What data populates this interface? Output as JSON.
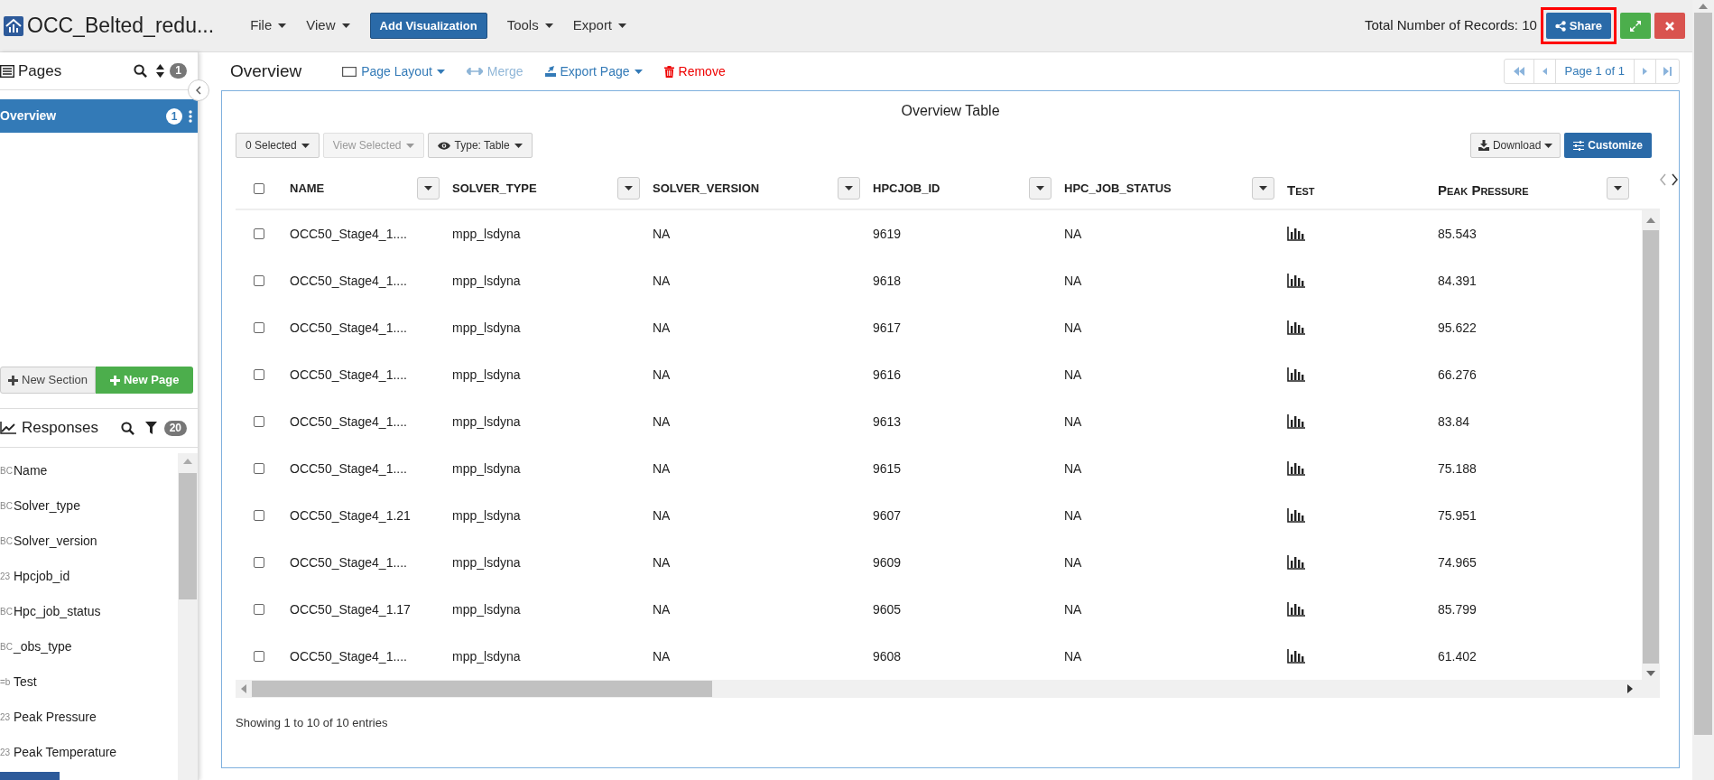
{
  "app": {
    "title": "OCC_Belted_redu..."
  },
  "menu": [
    {
      "kind": "dropdown",
      "label": "File"
    },
    {
      "kind": "dropdown",
      "label": "View"
    },
    {
      "kind": "primary",
      "label": "Add Visualization"
    },
    {
      "kind": "dropdown",
      "label": "Tools"
    },
    {
      "kind": "dropdown",
      "label": "Export"
    }
  ],
  "records": "Total Number of Records: 10",
  "share_button": {
    "label": "Share",
    "highlighted": true
  },
  "pages": {
    "title": "Pages",
    "count": "1",
    "items": [
      {
        "label": "Overview",
        "badge": "1",
        "selected": true
      }
    ],
    "new_section": "New Section",
    "new_page": "New Page"
  },
  "responses": {
    "title": "Responses",
    "count": "20",
    "items": [
      {
        "type_label": "BC",
        "label": "Name"
      },
      {
        "type_label": "BC",
        "label": "Solver_type"
      },
      {
        "type_label": "BC",
        "label": "Solver_version"
      },
      {
        "type_label": "23",
        "label": "Hpcjob_id"
      },
      {
        "type_label": "BC",
        "label": "Hpc_job_status"
      },
      {
        "type_label": "BC",
        "label": "_obs_type"
      },
      {
        "type_label": "=b",
        "label": "Test"
      },
      {
        "type_label": "23",
        "label": "Peak Pressure"
      },
      {
        "type_label": "23",
        "label": "Peak Temperature"
      }
    ]
  },
  "page": {
    "title": "Overview",
    "actions": [
      {
        "kind": "layout",
        "label": "Page Layout",
        "disabled": false
      },
      {
        "kind": "merge",
        "label": "Merge",
        "disabled": true
      },
      {
        "kind": "export",
        "label": "Export Page",
        "disabled": false
      },
      {
        "kind": "remove",
        "label": "Remove",
        "disabled": false
      }
    ],
    "pager": "Page 1 of 1"
  },
  "table": {
    "title": "Overview Table",
    "toolbar": [
      {
        "kind": "menu",
        "label": "0 Selected",
        "disabled": false
      },
      {
        "kind": "menu",
        "label": "View Selected",
        "disabled": true
      },
      {
        "kind": "view",
        "label": "Type: Table",
        "disabled": false
      }
    ],
    "select_all_checked": false,
    "download": "Download",
    "customize": "Customize",
    "columns": [
      {
        "kind": "text",
        "label": "NAME",
        "small_caps": false
      },
      {
        "kind": "text",
        "label": "SOLVER_TYPE",
        "small_caps": false
      },
      {
        "kind": "text",
        "label": "SOLVER_VERSION",
        "small_caps": false
      },
      {
        "kind": "text",
        "label": "HPCJOB_ID",
        "small_caps": false
      },
      {
        "kind": "text",
        "label": "HPC_JOB_STATUS",
        "small_caps": false
      },
      {
        "kind": "chart",
        "label": "Test",
        "small_caps": true
      },
      {
        "kind": "text",
        "label": "Peak Pressure",
        "small_caps": true
      }
    ],
    "rows": [
      {
        "checked": false,
        "cells": [
          "OCC50_Stage4_1....",
          "mpp_lsdyna",
          "NA",
          "9619",
          "NA",
          "",
          "85.543"
        ]
      },
      {
        "checked": false,
        "cells": [
          "OCC50_Stage4_1....",
          "mpp_lsdyna",
          "NA",
          "9618",
          "NA",
          "",
          "84.391"
        ]
      },
      {
        "checked": false,
        "cells": [
          "OCC50_Stage4_1....",
          "mpp_lsdyna",
          "NA",
          "9617",
          "NA",
          "",
          "95.622"
        ]
      },
      {
        "checked": false,
        "cells": [
          "OCC50_Stage4_1....",
          "mpp_lsdyna",
          "NA",
          "9616",
          "NA",
          "",
          "66.276"
        ]
      },
      {
        "checked": false,
        "cells": [
          "OCC50_Stage4_1....",
          "mpp_lsdyna",
          "NA",
          "9613",
          "NA",
          "",
          "83.84"
        ]
      },
      {
        "checked": false,
        "cells": [
          "OCC50_Stage4_1....",
          "mpp_lsdyna",
          "NA",
          "9615",
          "NA",
          "",
          "75.188"
        ]
      },
      {
        "checked": false,
        "cells": [
          "OCC50_Stage4_1.21",
          "mpp_lsdyna",
          "NA",
          "9607",
          "NA",
          "",
          "75.951"
        ]
      },
      {
        "checked": false,
        "cells": [
          "OCC50_Stage4_1....",
          "mpp_lsdyna",
          "NA",
          "9609",
          "NA",
          "",
          "74.965"
        ]
      },
      {
        "checked": false,
        "cells": [
          "OCC50_Stage4_1.17",
          "mpp_lsdyna",
          "NA",
          "9605",
          "NA",
          "",
          "85.799"
        ]
      },
      {
        "checked": false,
        "cells": [
          "OCC50_Stage4_1....",
          "mpp_lsdyna",
          "NA",
          "9608",
          "NA",
          "",
          "61.402"
        ]
      }
    ],
    "footer": "Showing 1 to 10 of 10 entries"
  }
}
